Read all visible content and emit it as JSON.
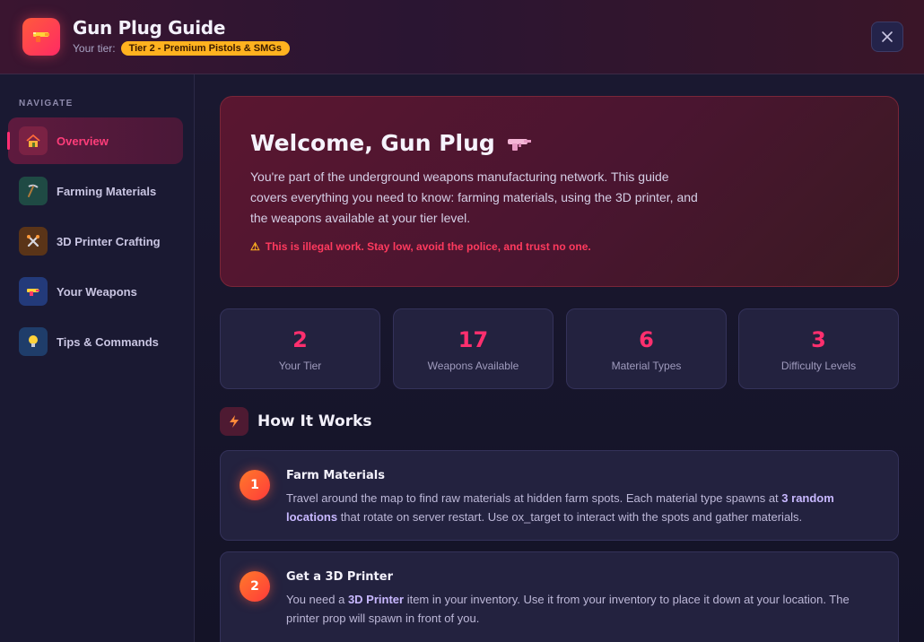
{
  "header": {
    "title": "Gun Plug Guide",
    "tier_label": "Your tier:",
    "tier_badge": "Tier 2 - Premium Pistols & SMGs",
    "icon": "gun-icon"
  },
  "sidebar": {
    "heading": "NAVIGATE",
    "items": [
      {
        "label": "Overview",
        "icon": "house-icon",
        "active": true
      },
      {
        "label": "Farming Materials",
        "icon": "pickaxe-icon"
      },
      {
        "label": "3D Printer Crafting",
        "icon": "tools-icon"
      },
      {
        "label": "Your Weapons",
        "icon": "gun-icon"
      },
      {
        "label": "Tips & Commands",
        "icon": "lightbulb-icon"
      }
    ]
  },
  "welcome": {
    "title": "Welcome, Gun Plug",
    "text": "You're part of the underground weapons manufacturing network. This guide covers everything you need to know: farming materials, using the 3D printer, and the weapons available at your tier level.",
    "warning": "This is illegal work. Stay low, avoid the police, and trust no one."
  },
  "stats": [
    {
      "value": "2",
      "label": "Your Tier"
    },
    {
      "value": "17",
      "label": "Weapons Available"
    },
    {
      "value": "6",
      "label": "Material Types"
    },
    {
      "value": "3",
      "label": "Difficulty Levels"
    }
  ],
  "how_it_works": {
    "title": "How It Works",
    "steps": [
      {
        "num": "1",
        "title": "Farm Materials",
        "text_a": "Travel around the map to find raw materials at hidden farm spots. Each material type spawns at ",
        "bold": "3 random locations",
        "text_b": " that rotate on server restart. Use ox_target to interact with the spots and gather materials."
      },
      {
        "num": "2",
        "title": "Get a 3D Printer",
        "text_a": "You need a ",
        "bold": "3D Printer",
        "text_b": " item in your inventory. Use it from your inventory to place it down at your location. The printer prop will spawn in front of you."
      }
    ]
  },
  "colors": {
    "accent": "#ff2f6e",
    "tier_badge": "#ffb21f",
    "warning": "#ff3a5e"
  }
}
